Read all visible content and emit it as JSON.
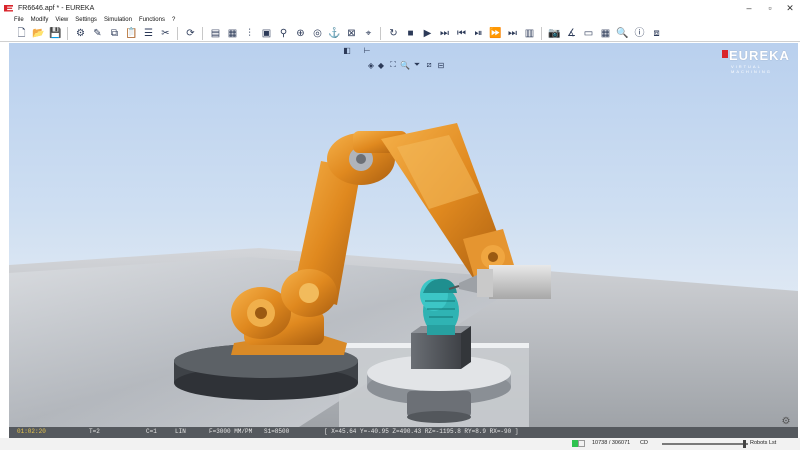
{
  "window": {
    "title": "FR6646.apf * - EUREKA",
    "min_glyph": "–",
    "max_glyph": "▫",
    "close_glyph": "✕"
  },
  "menu": [
    "File",
    "Modify",
    "View",
    "Settings",
    "Simulation",
    "Functions",
    "?"
  ],
  "toolbar": {
    "groups": [
      [
        {
          "name": "new-file-icon",
          "glyph": "🗋"
        },
        {
          "name": "open-folder-icon",
          "glyph": "📂"
        },
        {
          "name": "save-icon",
          "glyph": "💾"
        }
      ],
      [
        {
          "name": "robot-tool-icon",
          "glyph": "⚙"
        },
        {
          "name": "pencil-icon",
          "glyph": "✎"
        },
        {
          "name": "copy-icon",
          "glyph": "⧉"
        },
        {
          "name": "clipboard-icon",
          "glyph": "📋"
        },
        {
          "name": "list-icon",
          "glyph": "☰"
        },
        {
          "name": "tools-icon",
          "glyph": "✂"
        }
      ],
      [
        {
          "name": "refresh-icon",
          "glyph": "⟳"
        }
      ],
      [
        {
          "name": "report-icon",
          "glyph": "▤"
        },
        {
          "name": "table-icon",
          "glyph": "▦"
        },
        {
          "name": "chart-icon",
          "glyph": "⫶"
        },
        {
          "name": "document-icon",
          "glyph": "▣"
        },
        {
          "name": "pin-icon",
          "glyph": "⚲"
        },
        {
          "name": "target-icon",
          "glyph": "⊕"
        },
        {
          "name": "rotate-icon",
          "glyph": "◎"
        },
        {
          "name": "anchor-icon",
          "glyph": "⚓"
        },
        {
          "name": "collision-icon",
          "glyph": "⊠"
        },
        {
          "name": "measure-icon",
          "glyph": "⌖"
        }
      ],
      [
        {
          "name": "reset-icon",
          "glyph": "↻"
        },
        {
          "name": "stop-icon",
          "glyph": "■"
        },
        {
          "name": "play-icon",
          "glyph": "▶"
        },
        {
          "name": "step-icon",
          "glyph": "⏭"
        },
        {
          "name": "step-back-icon",
          "glyph": "⏮"
        },
        {
          "name": "step-block-icon",
          "glyph": "⏯"
        },
        {
          "name": "fast-forward-icon",
          "glyph": "⏩"
        },
        {
          "name": "skip-icon",
          "glyph": "⏭"
        },
        {
          "name": "export-icon",
          "glyph": "▥"
        }
      ],
      [
        {
          "name": "camera-icon",
          "glyph": "📷"
        },
        {
          "name": "angle-icon",
          "glyph": "∡"
        },
        {
          "name": "frame-icon",
          "glyph": "▭"
        },
        {
          "name": "grid-icon",
          "glyph": "▦"
        },
        {
          "name": "zoom-icon",
          "glyph": "🔍"
        },
        {
          "name": "info-icon",
          "glyph": "ⓘ"
        },
        {
          "name": "view-cube-icon",
          "glyph": "⧈"
        }
      ]
    ]
  },
  "view_tools": [
    {
      "name": "view-cube-icon",
      "glyph": "◧"
    },
    {
      "name": "axes-icon",
      "glyph": "⊢"
    },
    {
      "name": "iso-view-icon",
      "glyph": "◈"
    },
    {
      "name": "shade-view-icon",
      "glyph": "◆"
    },
    {
      "name": "fit-view-icon",
      "glyph": "⛶"
    },
    {
      "name": "zoom-view-icon",
      "glyph": "🔍"
    },
    {
      "name": "filter-icon",
      "glyph": "⏷"
    },
    {
      "name": "section-icon",
      "glyph": "⧄"
    },
    {
      "name": "layers-icon",
      "glyph": "⊟"
    }
  ],
  "logo": {
    "text": "EUREKA",
    "subtext": "VIRTUAL MACHINING"
  },
  "status": {
    "time": "01:02:20",
    "tool": "T=2",
    "correction": "C=1",
    "motion": "LIN",
    "feed": "F=3000 MM/PM",
    "spindle": "S1=8500",
    "coords": "[ X=45.64 Y=-40.95 Z=490.43 RZ=-1195.8 RY=8.9 RX=-90 ]"
  },
  "bottom": {
    "progress": 0.02,
    "counter": "10738 / 306071",
    "cd_label": "CD",
    "robot_label": "Robots Lst",
    "speed_fraction": 0.96
  },
  "colors": {
    "robot": "#e8962a",
    "workpiece": "#2fb3b3",
    "accent": "#d9242b"
  }
}
